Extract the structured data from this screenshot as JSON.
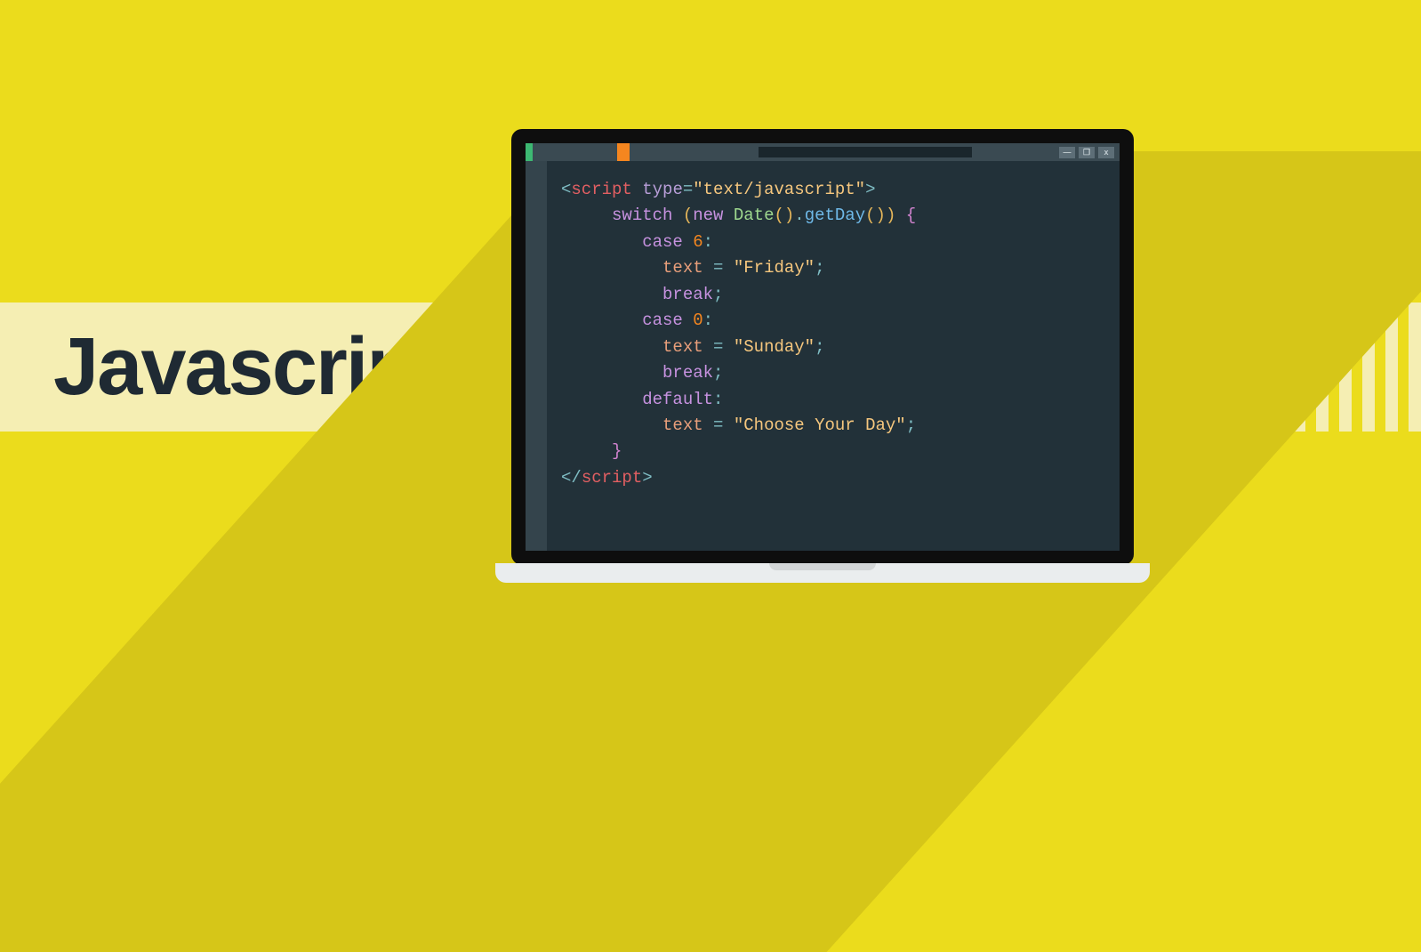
{
  "title": "Javascript",
  "code": {
    "line1": {
      "open": "<",
      "tag": "script",
      "sp": " ",
      "attr": "type",
      "eq": "=",
      "val": "\"text/javascript\"",
      "close": ">"
    },
    "line2": {
      "kw": "switch",
      "sp": " ",
      "lp": "(",
      "new": "new",
      "sp2": " ",
      "cls": "Date",
      "lp2": "(",
      "rp2": ")",
      "dot": ".",
      "fn": "getDay",
      "lp3": "(",
      "rp3": ")",
      "rp": ")",
      "sp3": " ",
      "lc": "{"
    },
    "line3": {
      "kw": "case",
      "sp": " ",
      "num": "6",
      "col": ":"
    },
    "line4": {
      "var": "text",
      "sp": " ",
      "eq": "=",
      "sp2": " ",
      "str": "\"Friday\"",
      "sc": ";"
    },
    "line5": {
      "kw": "break",
      "sc": ";"
    },
    "line6": {
      "kw": "case",
      "sp": " ",
      "num": "0",
      "col": ":"
    },
    "line7": {
      "var": "text",
      "sp": " ",
      "eq": "=",
      "sp2": " ",
      "str": "\"Sunday\"",
      "sc": ";"
    },
    "line8": {
      "kw": "break",
      "sc": ";"
    },
    "line9": {
      "kw": "default",
      "col": ":"
    },
    "line10": {
      "var": "text",
      "sp": " ",
      "eq": "=",
      "sp2": " ",
      "str": "\"Choose Your Day\"",
      "sc": ";"
    },
    "line11": {
      "rc": "}"
    },
    "line12": {
      "open": "</",
      "tag": "script",
      "close": ">"
    }
  },
  "window_controls": {
    "min": "—",
    "max": "❐",
    "close": "x"
  }
}
